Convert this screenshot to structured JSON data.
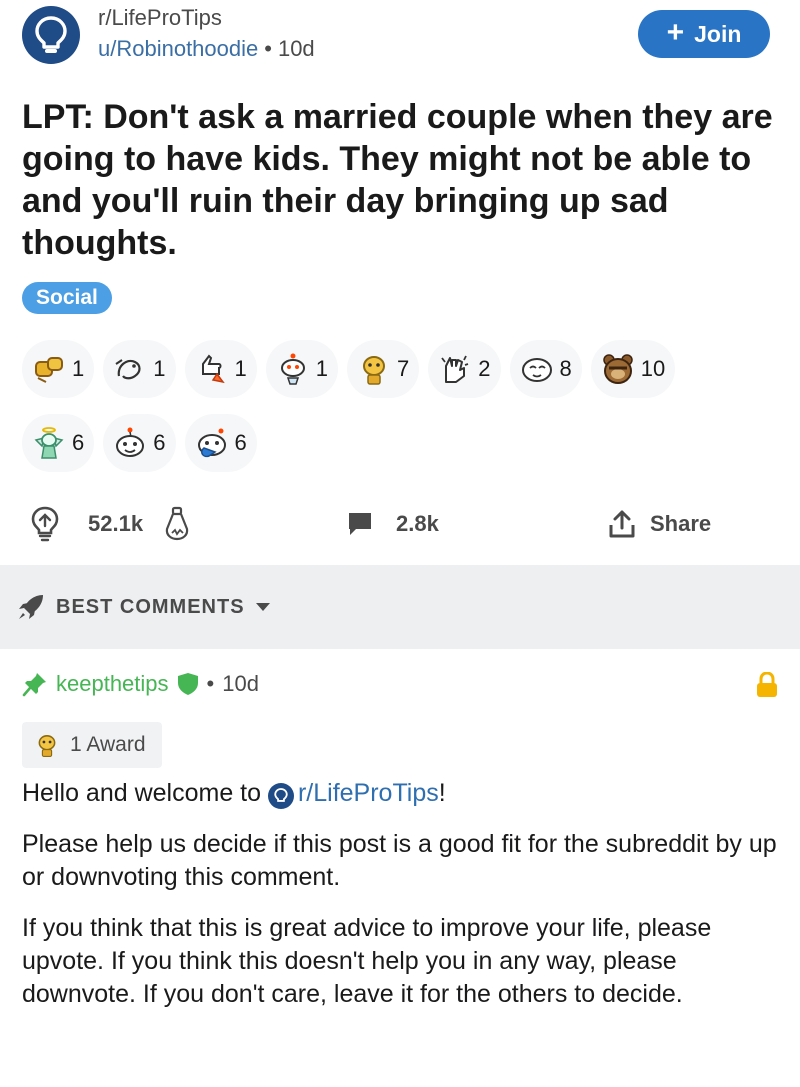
{
  "post": {
    "subreddit": "r/LifeProTips",
    "author": "u/Robinothoodie",
    "separator": "•",
    "age": "10d",
    "join_label": "Join",
    "title": "LPT: Don't ask a married couple when they are going to have kids. They might not be able to and you'll ruin their day bringing up sad thoughts.",
    "flair": "Social"
  },
  "awards": {
    "row1": [
      {
        "icon": "fist-bump-award-icon",
        "count": "1"
      },
      {
        "icon": "snek-award-icon",
        "count": "1"
      },
      {
        "icon": "rocket-like-award-icon",
        "count": "1"
      },
      {
        "icon": "wholesome-snoo-award-icon",
        "count": "1"
      },
      {
        "icon": "helpful-award-icon",
        "count": "7"
      },
      {
        "icon": "clap-award-icon",
        "count": "2"
      },
      {
        "icon": "blush-face-award-icon",
        "count": "8"
      },
      {
        "icon": "facepalm-bear-award-icon",
        "count": "10"
      }
    ],
    "row2": [
      {
        "icon": "angel-award-icon",
        "count": "6"
      },
      {
        "icon": "snoo-face-award-icon",
        "count": "6"
      },
      {
        "icon": "snoo-tear-award-icon",
        "count": "6"
      }
    ]
  },
  "actions": {
    "upvotes": "52.1k",
    "comments": "2.8k",
    "share_label": "Share"
  },
  "sort": {
    "label": "BEST COMMENTS"
  },
  "comment": {
    "author": "keepthetips",
    "separator": "•",
    "age": "10d",
    "award_label": "1 Award",
    "p1_prefix": "Hello and welcome to ",
    "p1_link": "r/LifeProTips",
    "p1_suffix": "!",
    "p2": "Please help us decide if this post is a good fit for the subreddit by up or downvoting this comment.",
    "p3": "If you think that this is great advice to improve your life, please upvote. If you think this doesn't help you in any way, please downvote. If you don't care, leave it for the others to decide."
  },
  "colors": {
    "join_button": "#2a74c6",
    "flair": "#4c9fe5",
    "mod_green": "#46b553",
    "lock": "#f5b400",
    "link": "#2f6fb0"
  }
}
